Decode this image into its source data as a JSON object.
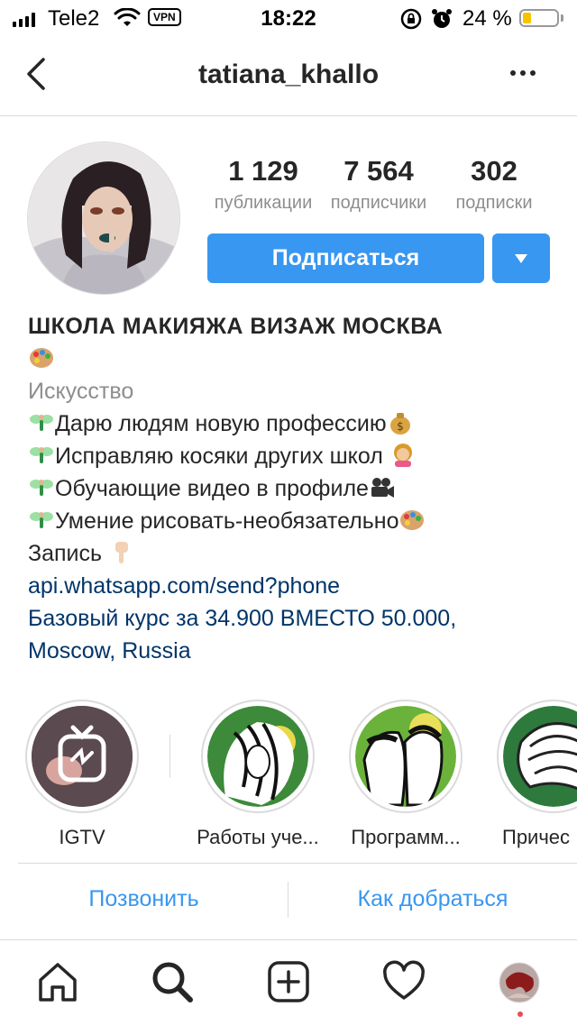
{
  "status_bar": {
    "carrier": "Tele2",
    "vpn": "VPN",
    "time": "18:22",
    "battery": "24 %",
    "battery_level": 0.24
  },
  "header": {
    "username": "tatiana_khallo",
    "back_icon": "chevron-left-icon",
    "more_icon": "more-dots-icon"
  },
  "stats": [
    {
      "value": "1 129",
      "label": "публикации"
    },
    {
      "value": "7 564",
      "label": "подписчики"
    },
    {
      "value": "302",
      "label": "подписки"
    }
  ],
  "actions": {
    "subscribe": "Подписаться",
    "dropdown_icon": "caret-down-icon"
  },
  "bio": {
    "name": "ШКОЛА МАКИЯЖА ВИЗАЖ МОСКВА",
    "category": "Искусство",
    "lines": [
      "Дарю людям новую профессию",
      "Исправляю косяки других школ",
      "Обучающие видео в профиле",
      "Умение рисовать-необязательно"
    ],
    "record": "Запись",
    "link": "api.whatsapp.com/send?phone",
    "course": "Базовый курс за 34.900 ВМЕСТО 50.000,",
    "location": "Moscow, Russia"
  },
  "highlights": [
    {
      "label": "IGTV"
    },
    {
      "label": "Работы уче..."
    },
    {
      "label": "Программ..."
    },
    {
      "label": "Причес"
    }
  ],
  "contact": {
    "call": "Позвонить",
    "directions": "Как добраться"
  },
  "tabbar": [
    "home-icon",
    "search-icon",
    "new-post-icon",
    "activity-heart-icon",
    "profile-avatar-icon"
  ],
  "colors": {
    "accent": "#3897f0",
    "link": "#003569",
    "secondary_text": "#8e8e8e",
    "divider": "#dbdbdb"
  }
}
